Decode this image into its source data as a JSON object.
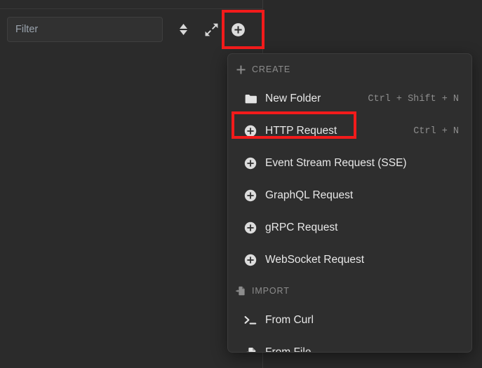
{
  "sidebar": {
    "filter": {
      "placeholder": "Filter",
      "value": ""
    },
    "toolbar_buttons": [
      {
        "name": "sort-button",
        "icon": "sort-icon",
        "label": "Sort"
      },
      {
        "name": "expand-all-button",
        "icon": "expand-arrows-icon",
        "label": "Expand all"
      },
      {
        "name": "create-button",
        "icon": "plus-circle-icon",
        "label": "Create"
      }
    ]
  },
  "menu": {
    "sections": [
      {
        "header": "CREATE",
        "header_icon": "plus-icon",
        "items": [
          {
            "label": "New Folder",
            "icon": "folder-icon",
            "shortcut": "Ctrl + Shift + N"
          },
          {
            "label": "HTTP Request",
            "icon": "plus-circle-icon",
            "shortcut": "Ctrl + N"
          },
          {
            "label": "Event Stream Request (SSE)",
            "icon": "plus-circle-icon",
            "shortcut": ""
          },
          {
            "label": "GraphQL Request",
            "icon": "plus-circle-icon",
            "shortcut": ""
          },
          {
            "label": "gRPC Request",
            "icon": "plus-circle-icon",
            "shortcut": ""
          },
          {
            "label": "WebSocket Request",
            "icon": "plus-circle-icon",
            "shortcut": ""
          }
        ]
      },
      {
        "header": "IMPORT",
        "header_icon": "file-import-icon",
        "items": [
          {
            "label": "From Curl",
            "icon": "terminal-prompt-icon",
            "shortcut": ""
          },
          {
            "label": "From File",
            "icon": "file-import-icon",
            "shortcut": ""
          }
        ]
      }
    ]
  },
  "highlights": [
    {
      "name": "create-button-highlight",
      "color": "#f21b1b"
    },
    {
      "name": "http-request-highlight",
      "color": "#f21b1b"
    }
  ]
}
